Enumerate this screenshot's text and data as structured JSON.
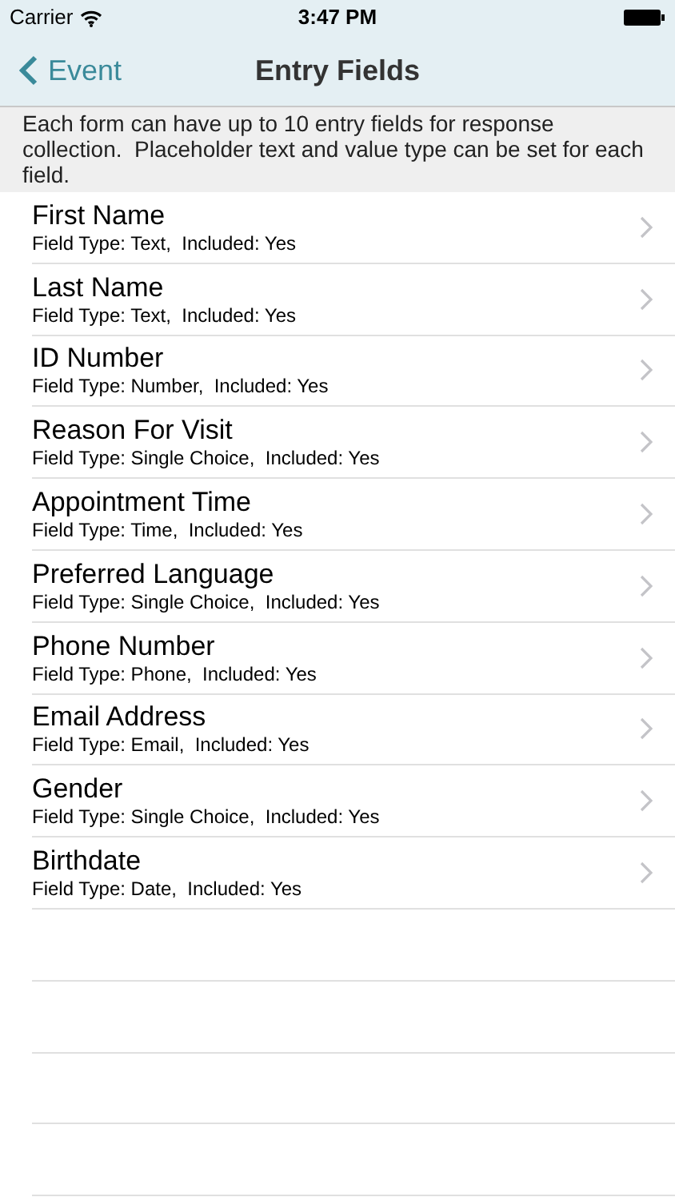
{
  "status_bar": {
    "carrier": "Carrier",
    "time": "3:47 PM"
  },
  "nav": {
    "back": "Event",
    "title": "Entry Fields"
  },
  "info": "Each form can have up to 10 entry fields for response collection.  Placeholder text and value type can be set for each field.",
  "fields": [
    {
      "name": "First Name",
      "detail": "Field Type: Text,  Included: Yes"
    },
    {
      "name": "Last Name",
      "detail": "Field Type: Text,  Included: Yes"
    },
    {
      "name": "ID Number",
      "detail": "Field Type: Number,  Included: Yes"
    },
    {
      "name": "Reason For Visit",
      "detail": "Field Type: Single Choice,  Included: Yes"
    },
    {
      "name": "Appointment Time",
      "detail": "Field Type: Time,  Included: Yes"
    },
    {
      "name": "Preferred Language",
      "detail": "Field Type: Single Choice,  Included: Yes"
    },
    {
      "name": "Phone Number",
      "detail": "Field Type: Phone,  Included: Yes"
    },
    {
      "name": "Email Address",
      "detail": "Field Type: Email,  Included: Yes"
    },
    {
      "name": "Gender",
      "detail": "Field Type: Single Choice,  Included: Yes"
    },
    {
      "name": "Birthdate",
      "detail": "Field Type: Date,  Included: Yes"
    }
  ]
}
